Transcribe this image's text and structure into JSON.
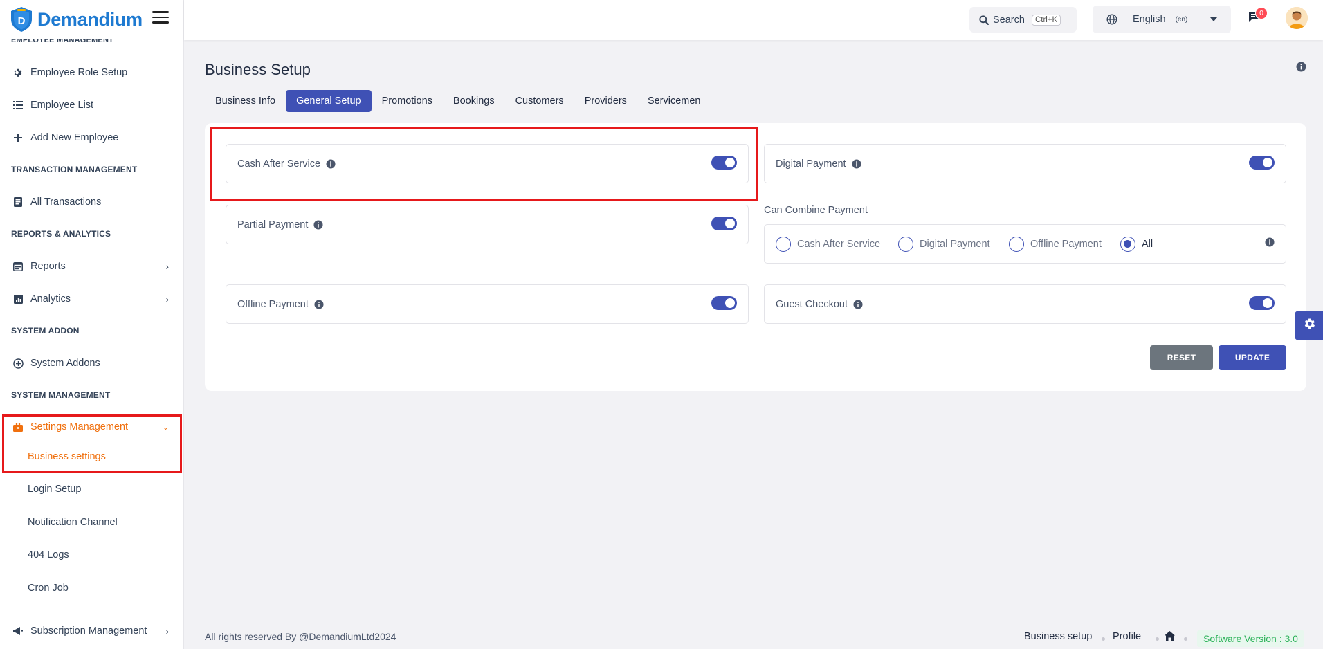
{
  "brand": {
    "name": "Demandium"
  },
  "sidebar": {
    "cut_section": "EMPLOYEE MANAGEMENT",
    "items": [
      {
        "label": "Employee Role Setup"
      },
      {
        "label": "Employee List"
      },
      {
        "label": "Add New Employee"
      },
      {
        "label": "All Transactions"
      },
      {
        "label": "Reports"
      },
      {
        "label": "Analytics"
      },
      {
        "label": "System Addons"
      },
      {
        "label": "Settings Management"
      },
      {
        "label": "Subscription Management"
      }
    ],
    "sections": {
      "transaction": "TRANSACTION MANAGEMENT",
      "reports": "REPORTS & ANALYTICS",
      "addon": "SYSTEM ADDON",
      "system": "SYSTEM MANAGEMENT"
    },
    "sub_items": [
      {
        "label": "Business settings"
      },
      {
        "label": "Login Setup"
      },
      {
        "label": "Notification Channel"
      },
      {
        "label": "404 Logs"
      },
      {
        "label": "Cron Job"
      }
    ]
  },
  "header": {
    "search_label": "Search",
    "search_shortcut": "Ctrl+K",
    "language": "English",
    "language_code": "(en)",
    "message_count": "0"
  },
  "main": {
    "title": "Business Setup",
    "tabs": [
      {
        "label": "Business Info"
      },
      {
        "label": "General Setup"
      },
      {
        "label": "Promotions"
      },
      {
        "label": "Bookings"
      },
      {
        "label": "Customers"
      },
      {
        "label": "Providers"
      },
      {
        "label": "Servicemen"
      }
    ],
    "active_tab": "General Setup",
    "options": {
      "cash_after_service": {
        "label": "Cash After Service",
        "enabled": true
      },
      "digital_payment": {
        "label": "Digital Payment",
        "enabled": true
      },
      "partial_payment": {
        "label": "Partial Payment",
        "enabled": true
      },
      "offline_payment": {
        "label": "Offline Payment",
        "enabled": true
      },
      "guest_checkout": {
        "label": "Guest Checkout",
        "enabled": true
      }
    },
    "combine": {
      "label": "Can Combine Payment",
      "options": [
        "Cash After Service",
        "Digital Payment",
        "Offline Payment",
        "All"
      ],
      "selected": "All"
    },
    "buttons": {
      "reset": "RESET",
      "update": "UPDATE"
    }
  },
  "footer": {
    "copyright": "All rights reserved By @DemandiumLtd2024",
    "links": [
      "Business setup",
      "Profile"
    ],
    "version": "Software Version : 3.0"
  },
  "colors": {
    "primary": "#3f51b5",
    "brand": "#1e7ad1",
    "active_nav": "#f0700e",
    "highlight": "#e6191b",
    "version_bg": "#e8f7ee",
    "version_text": "#2db35a"
  }
}
